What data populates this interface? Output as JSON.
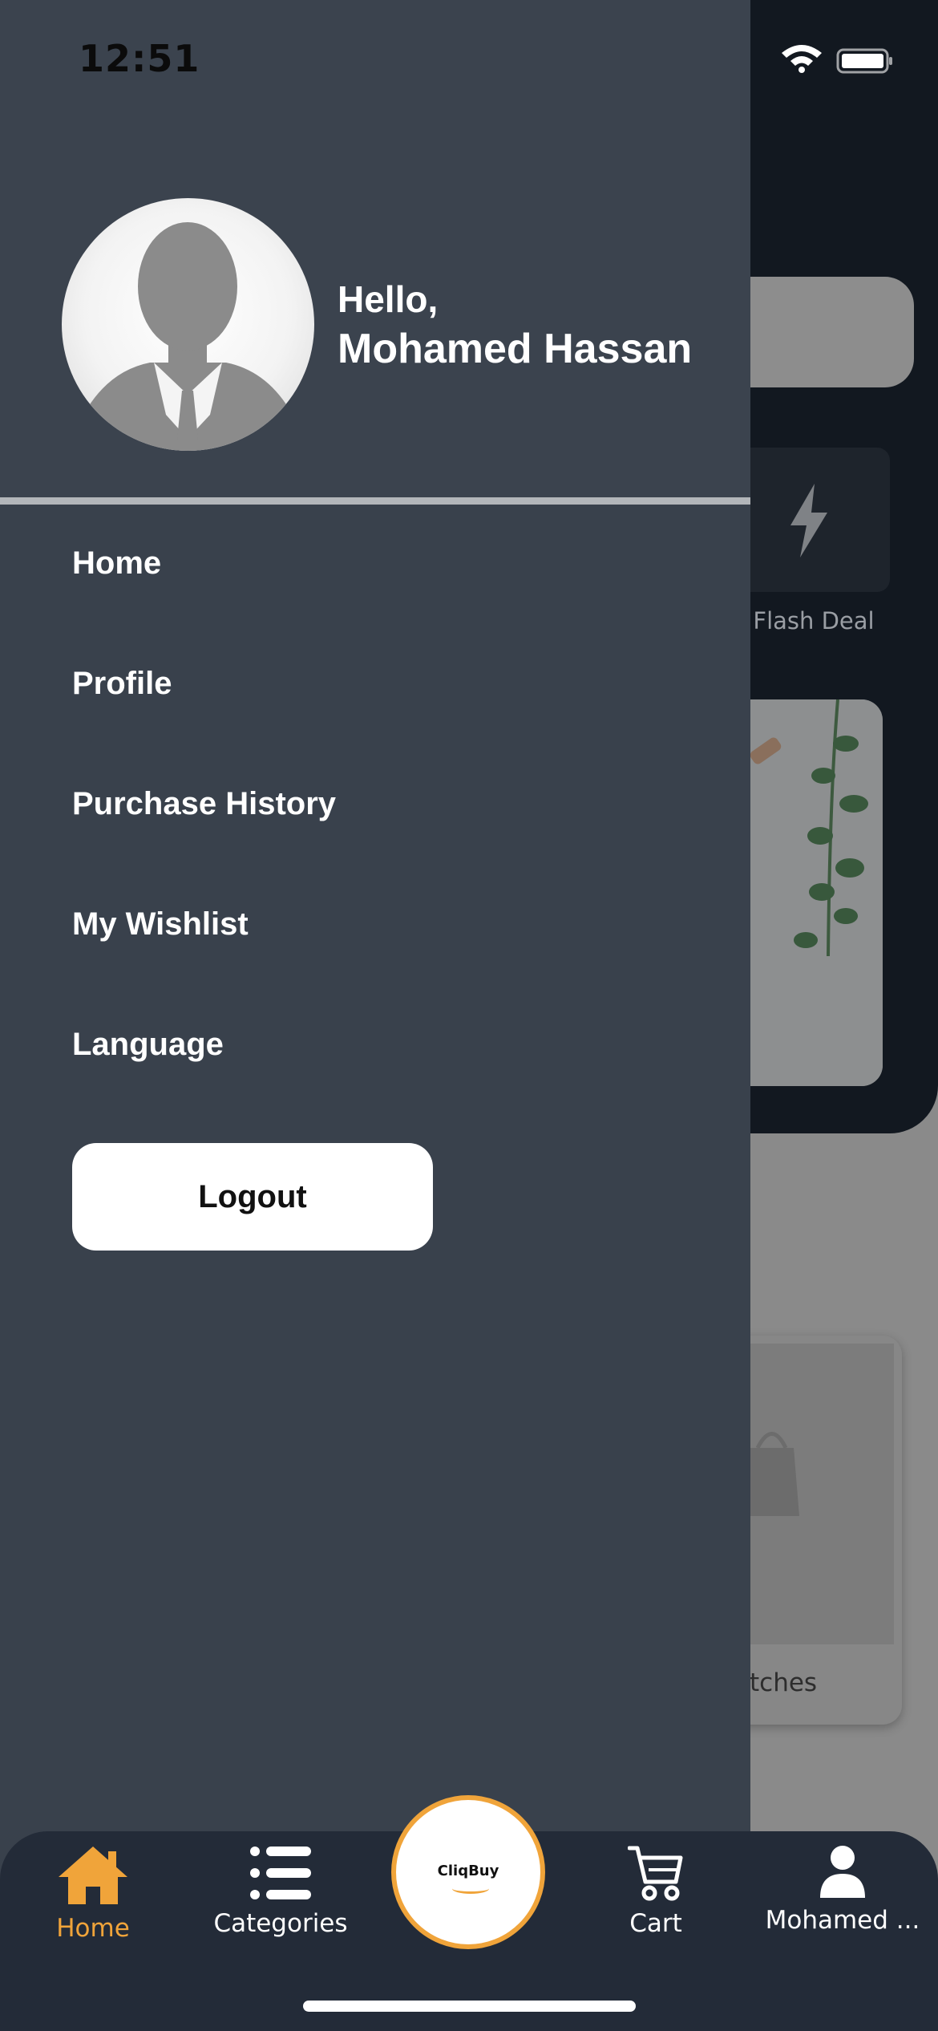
{
  "status_bar": {
    "time": "12:51"
  },
  "background": {
    "flash_deal_label": "Flash Deal",
    "card_label_partial": "tches"
  },
  "drawer": {
    "greeting": "Hello,",
    "user_name": "Mohamed Hassan",
    "menu": [
      {
        "label": "Home"
      },
      {
        "label": "Profile"
      },
      {
        "label": "Purchase History"
      },
      {
        "label": "My Wishlist"
      },
      {
        "label": "Language"
      }
    ],
    "logout_label": "Logout"
  },
  "bottom_nav": {
    "items": [
      {
        "label": "Home",
        "icon": "home-icon",
        "active": true
      },
      {
        "label": "Categories",
        "icon": "list-icon",
        "active": false
      },
      {
        "label": "Cart",
        "icon": "cart-icon",
        "active": false
      },
      {
        "label": "Mohamed ...",
        "icon": "user-icon",
        "active": false
      }
    ],
    "center_logo": "CliqBuy"
  },
  "colors": {
    "drawer_bg": "#39414c",
    "accent": "#f0a43a",
    "nav_bg": "#232b38"
  }
}
